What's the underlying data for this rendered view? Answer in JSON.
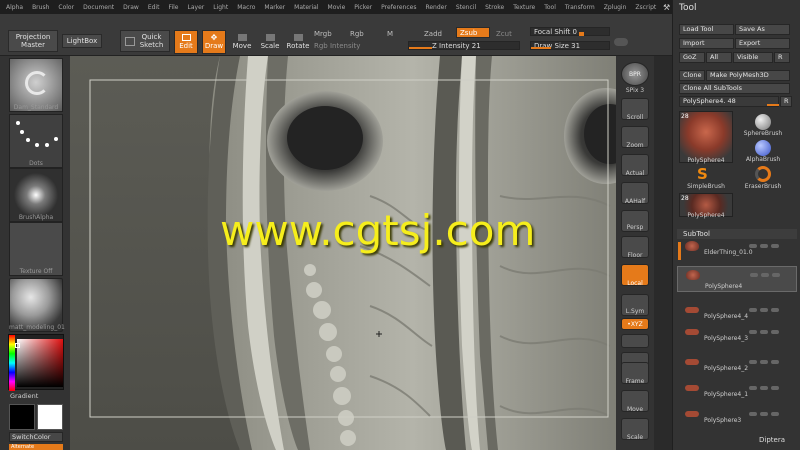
{
  "menu": [
    "Alpha",
    "Brush",
    "Color",
    "Document",
    "Draw",
    "Edit",
    "File",
    "Layer",
    "Light",
    "Macro",
    "Marker",
    "Material",
    "Movie",
    "Picker",
    "Preferences",
    "Render",
    "Stencil",
    "Stroke",
    "Texture",
    "Tool",
    "Transform",
    "Zplugin",
    "Zscript"
  ],
  "toolbar": {
    "projection_master": "Projection Master",
    "lightbox": "LightBox",
    "quick_sketch": "Quick Sketch",
    "edit": "Edit",
    "draw": "Draw",
    "move": "Move",
    "scale": "Scale",
    "rotate": "Rotate",
    "mrgb": "Mrgb",
    "rgb": "Rgb",
    "m": "M",
    "rgb_intensity": "Rgb Intensity",
    "zadd": "Zadd",
    "zsub": "Zsub",
    "zcut": "Zcut",
    "z_intensity_label": "Z Intensity",
    "z_intensity_value": "21",
    "focal_shift_label": "Focal Shift",
    "focal_shift_value": "0",
    "draw_size_label": "Draw Size",
    "draw_size_value": "31",
    "draw_size_fraction": 0.25,
    "z_intensity_fraction": 0.21
  },
  "left_shelf": {
    "brush_label": "Dam_Standard",
    "stroke_label": "Dots",
    "alpha_label": "BrushAlpha",
    "texture_label": "Texture Off",
    "material_label": "matt_modeling_01",
    "gradient_label": "Gradient",
    "switch_color_label": "SwitchColor",
    "alternate_label": "Alternate"
  },
  "watermark": "www.cgtsj.com",
  "right_bar": {
    "bpr": "BPR",
    "spix_label": "SPix",
    "spix_value": "3",
    "scroll": "Scroll",
    "zoom": "Zoom",
    "actual": "Actual",
    "aahalf": "AAHalf",
    "persp": "Persp",
    "floor": "Floor",
    "local": "Local",
    "lsym": "L.Sym",
    "xyz": "•XYZ",
    "frame": "Frame",
    "move": "Move",
    "scale": "Scale"
  },
  "tool_panel": {
    "title": "Tool",
    "load_tool": "Load Tool",
    "save_as": "Save As",
    "import": "Import",
    "export": "Export",
    "goz": "GoZ",
    "all": "All",
    "visible": "Visible",
    "r": "R",
    "clone": "Clone",
    "make_polymesh": "Make PolyMesh3D",
    "clone_all": "Clone All SubTools",
    "current_tool": "PolySphere4. 48",
    "thumb_count_1": "28",
    "thumb_count_2": "28",
    "tools": [
      "PolySphere4",
      "SphereBrush",
      "AlphaBrush",
      "SimpleBrush",
      "EraserBrush",
      "PolySphere4"
    ],
    "subtool_title": "SubTool",
    "subtools": [
      "ElderThing_01.0",
      "PolySphere4",
      "PolySphere4_4",
      "PolySphere4_3",
      "PolySphere4_2",
      "PolySphere4_1",
      "PolySphere3"
    ],
    "footer": "Diptera"
  }
}
